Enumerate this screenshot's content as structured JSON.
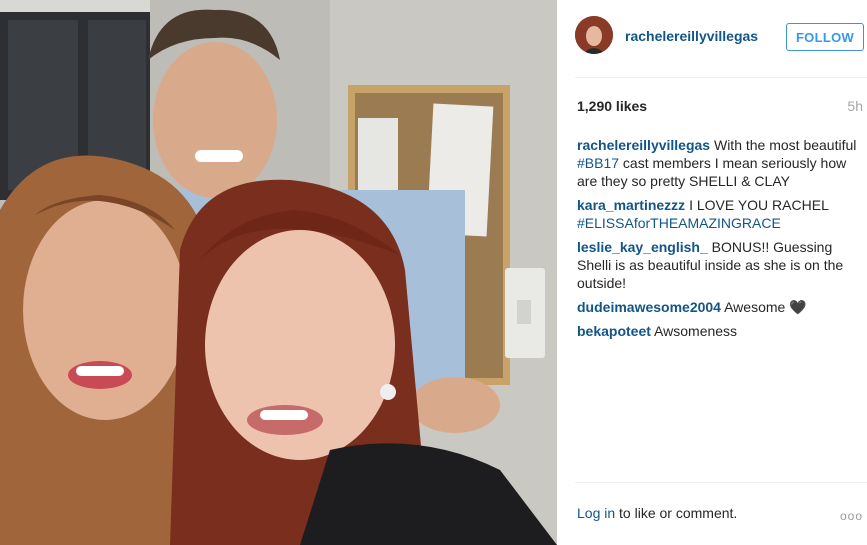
{
  "post": {
    "username": "rachelereillyvillegas",
    "follow_label": "FOLLOW",
    "likes": "1,290 likes",
    "time": "5h"
  },
  "comments": [
    {
      "user": "rachelereillyvillegas",
      "pre": "With the most beautiful ",
      "tag": "#BB17",
      "post": " cast members I mean seriously how are they so pretty SHELLI & CLAY"
    },
    {
      "user": "kara_martinezzz",
      "pre": "I LOVE YOU RACHEL ",
      "tag": "#ELISSAforTHEAMAZINGRACE",
      "post": ""
    },
    {
      "user": "leslie_kay_english_",
      "pre": "BONUS!! Guessing Shelli is as beautiful inside as she is on the outside!",
      "tag": "",
      "post": ""
    },
    {
      "user": "dudeimawesome2004",
      "pre": "Awesome ",
      "tag": "",
      "post": "🖤"
    },
    {
      "user": "bekapoteet",
      "pre": "Awsomeness",
      "tag": "",
      "post": ""
    }
  ],
  "footer": {
    "login_label": "Log in",
    "rest": " to like or comment.",
    "more_label": "ooo"
  },
  "icons": {
    "more": "more-options-icon"
  }
}
